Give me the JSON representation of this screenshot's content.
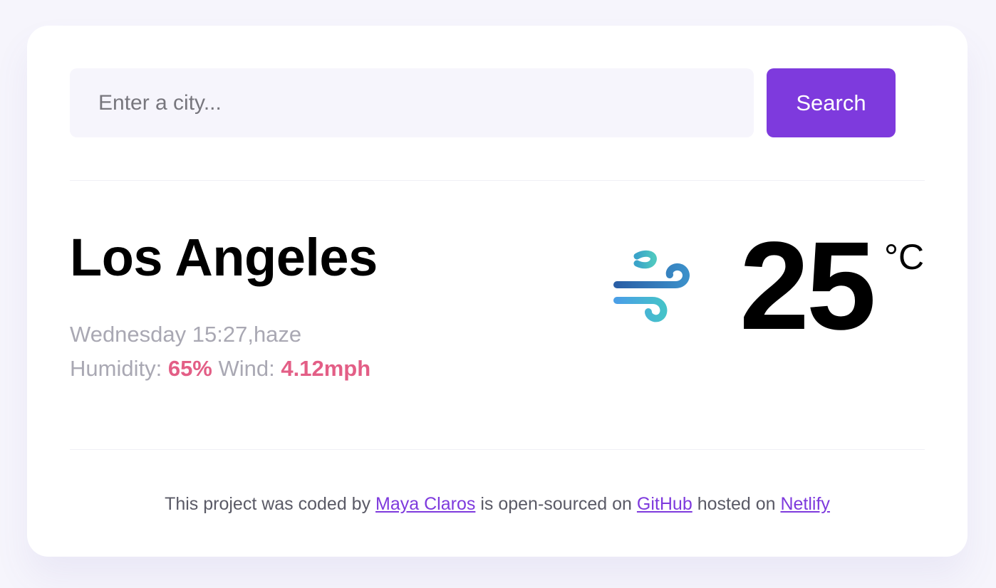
{
  "search": {
    "placeholder": "Enter a city...",
    "value": "",
    "button_label": "Search"
  },
  "weather": {
    "city": "Los Angeles",
    "datetime_condition": "Wednesday 15:27,haze",
    "humidity_label": "Humidity:",
    "humidity_value": "65%",
    "wind_label": "Wind:",
    "wind_value": "4.12mph",
    "icon": "wind-icon",
    "temperature": "25",
    "unit": "°C"
  },
  "footer": {
    "text_1": "This project was coded by",
    "author": "Maya Claros",
    "text_2": "is open-sourced on",
    "github": "GitHub",
    "text_3": "hosted on",
    "netlify": "Netlify"
  },
  "colors": {
    "accent": "#7e3add",
    "highlight": "#e35e86",
    "muted_text": "#a9a8b3",
    "background": "#f6f5fc"
  }
}
